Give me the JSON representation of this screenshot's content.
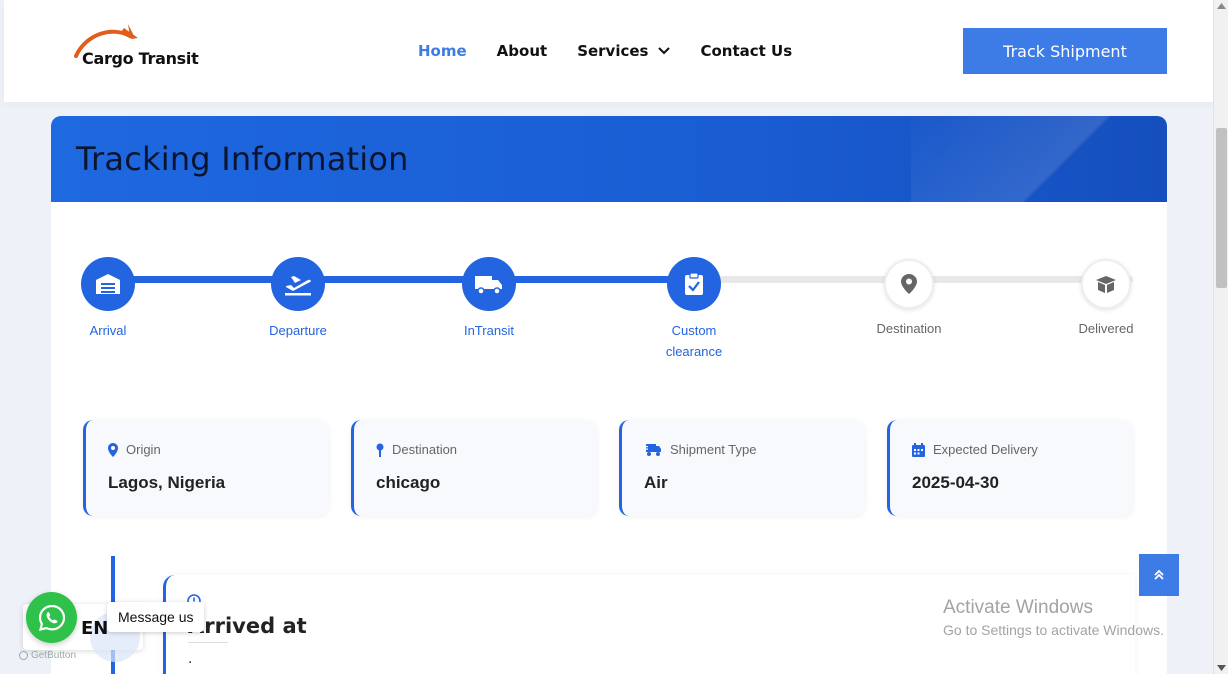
{
  "header": {
    "logo_text": "Cargo Transit",
    "nav": [
      {
        "label": "Home",
        "active": true
      },
      {
        "label": "About",
        "active": false
      },
      {
        "label": "Services",
        "active": false,
        "has_dropdown": true
      },
      {
        "label": "Contact Us",
        "active": false
      }
    ],
    "cta_label": "Track Shipment"
  },
  "card": {
    "title": "Tracking Information"
  },
  "steps": [
    {
      "label": "Arrival",
      "icon": "warehouse-icon",
      "done": true
    },
    {
      "label": "Departure",
      "icon": "plane-departure-icon",
      "done": true
    },
    {
      "label": "InTransit",
      "icon": "truck-icon",
      "done": true
    },
    {
      "label": "Custom clearance",
      "icon": "clipboard-check-icon",
      "done": true
    },
    {
      "label": "Destination",
      "icon": "map-pin-icon",
      "done": false
    },
    {
      "label": "Delivered",
      "icon": "box-open-icon",
      "done": false
    }
  ],
  "progress_fraction": 0.574,
  "info": [
    {
      "label": "Origin",
      "value": "Lagos, Nigeria",
      "icon": "map-marker-icon"
    },
    {
      "label": "Destination",
      "value": "chicago",
      "icon": "map-pin-icon"
    },
    {
      "label": "Shipment Type",
      "value": "Air",
      "icon": "truck-fast-icon"
    },
    {
      "label": "Expected Delivery",
      "value": "2025-04-30",
      "icon": "calendar-icon"
    }
  ],
  "timeline": {
    "title": "Arrived at",
    "detail": "."
  },
  "widgets": {
    "language": "EN",
    "message": "Message us",
    "getbutton": "GetButton"
  },
  "os_notice": {
    "line1": "Activate Windows",
    "line2": "Go to Settings to activate Windows."
  },
  "colors": {
    "primary": "#2364e0",
    "accent": "#3d7be6",
    "whatsapp": "#2fc24b"
  }
}
